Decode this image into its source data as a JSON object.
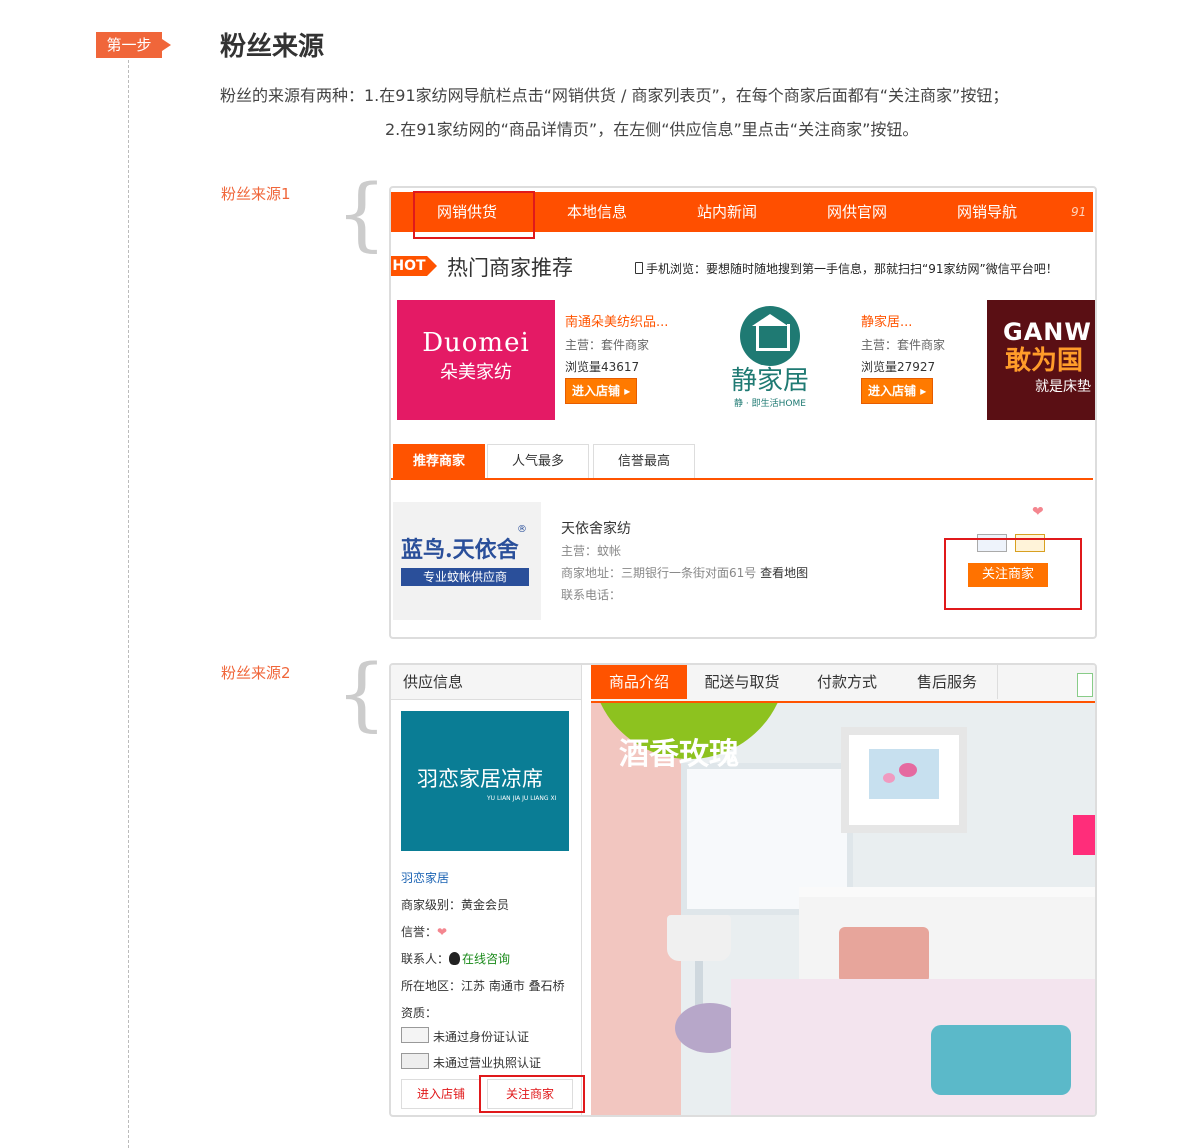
{
  "step": {
    "badge": "第一步",
    "title": "粉丝来源"
  },
  "description": {
    "line1": "粉丝的来源有两种：1.在91家纺网导航栏点击“网销供货 / 商家列表页”，在每个商家后面都有“关注商家”按钮；",
    "line2": "2.在91家纺网的“商品详情页”，在左侧“供应信息”里点击“关注商家”按钮。"
  },
  "source1": {
    "label": "粉丝来源1",
    "nav": [
      "网销供货",
      "本地信息",
      "站内新闻",
      "网供官网",
      "网销导航"
    ],
    "nav_trail": "91",
    "hot_badge": "HOT",
    "hot_title": "热门商家推荐",
    "mobile_tip": "手机浏览：要想随时随地搜到第一手信息，那就扫扫“91家纺网”微信平台吧！",
    "merchants": [
      {
        "logo_en": "Duomei",
        "logo_cn": "朵美家纺",
        "name": "南通朵美纺织品...",
        "main": "主营：套件商家",
        "views": "浏览量43617",
        "enter": "进入店铺"
      },
      {
        "logo_cn": "静家居",
        "logo_sub": "静 · 即生活HOME",
        "name": "静家居...",
        "main": "主营：套件商家",
        "views": "浏览量27927",
        "enter": "进入店铺"
      },
      {
        "logo_en": "GANW",
        "logo_cn": "敢为国",
        "logo_sub": "就是床垫"
      }
    ],
    "tabs": [
      "推荐商家",
      "人气最多",
      "信誉最高"
    ],
    "listing": {
      "logo_cn": "蓝鸟.天依舍",
      "logo_tag": "专业蚊帐供应商",
      "logo_mark": "®",
      "name": "天依舍家纺",
      "main": "主营：蚊帐",
      "address": "商家地址：三期银行一条街对面61号",
      "map_link": "查看地图",
      "phone": "联系电话：",
      "follow": "关注商家"
    }
  },
  "source2": {
    "label": "粉丝来源2",
    "sidebar_title": "供应信息",
    "logo_cn": "羽恋家居凉席",
    "logo_en": "YU LIAN JIA JU LIANG XI",
    "shop_name": "羽恋家居",
    "level": "商家级别：黄金会员",
    "credit": "信誉：",
    "contact_label": "联系人：",
    "contact_link": "在线咨询",
    "region": "所在地区：江苏 南通市 叠石桥",
    "qualification": "资质：",
    "id_cert": "未通过身份证认证",
    "license_cert": "未通过营业执照认证",
    "enter_shop": "进入店铺",
    "follow": "关注商家",
    "tabs": [
      "商品介绍",
      "配送与取货",
      "付款方式",
      "售后服务"
    ],
    "product_title": "酒香玫瑰"
  },
  "colors": {
    "accent": "#ff5300",
    "step": "#f0663a",
    "highlight": "#e0191b"
  }
}
